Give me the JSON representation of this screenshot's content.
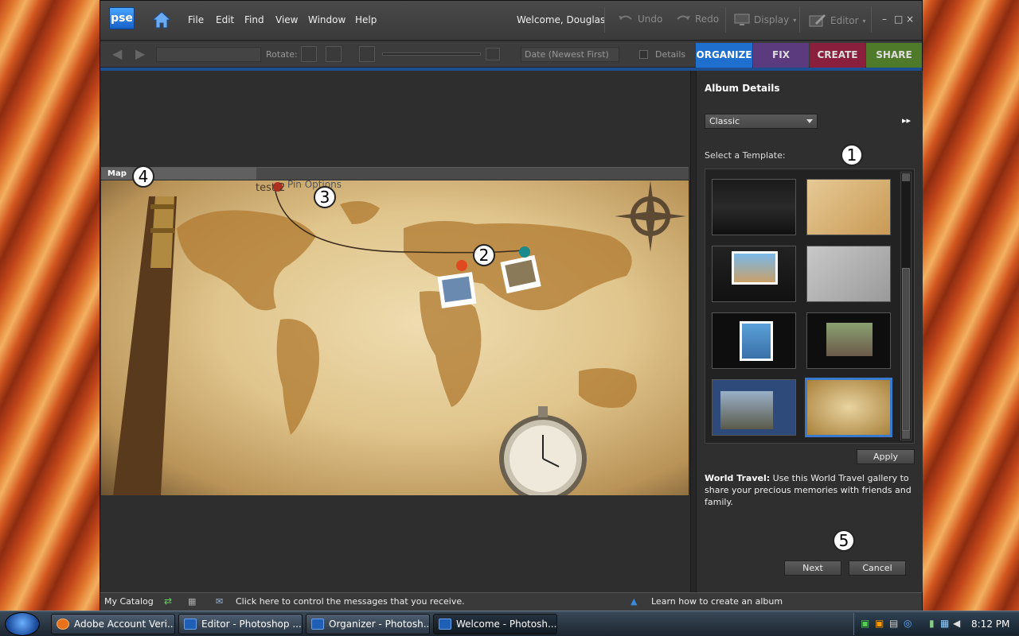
{
  "menubar": {
    "logo": "pse",
    "items": [
      "File",
      "Edit",
      "Find",
      "View",
      "Window",
      "Help"
    ],
    "welcome": "Welcome, Douglas",
    "undo": "Undo",
    "redo": "Redo",
    "display": "Display",
    "editor": "Editor",
    "win_controls": [
      "–",
      "□",
      "×"
    ]
  },
  "toolbar": {
    "rotate": "Rotate:",
    "sort": "Date (Newest First)",
    "details": "Details"
  },
  "tabs": [
    {
      "label": "ORGANIZE",
      "color": "#1f6fcf"
    },
    {
      "label": "FIX",
      "color": "#5b3a7d"
    },
    {
      "label": "CREATE",
      "color": "#8a1f3d"
    },
    {
      "label": "SHARE",
      "color": "#4f7a2a"
    }
  ],
  "map": {
    "title": "Map",
    "pin_options": "Pin Options",
    "pin_label": "test 2"
  },
  "right": {
    "title": "Album Details",
    "style_select": "Classic",
    "select_template": "Select a Template:",
    "apply": "Apply",
    "desc_bold": "World Travel:",
    "desc_text": " Use this World Travel gallery to share your precious memories with friends and family.",
    "next": "Next",
    "cancel": "Cancel"
  },
  "status": {
    "catalog": "My Catalog",
    "message": "Click here to control the messages that you receive.",
    "learn": "Learn how to create an album"
  },
  "callouts": [
    "1",
    "2",
    "3",
    "4",
    "5"
  ],
  "taskbar": {
    "items": [
      "Adobe Account Veri...",
      "Editor - Photoshop ...",
      "Organizer - Photosh...",
      "Welcome - Photosh..."
    ],
    "clock": "8:12 PM"
  }
}
